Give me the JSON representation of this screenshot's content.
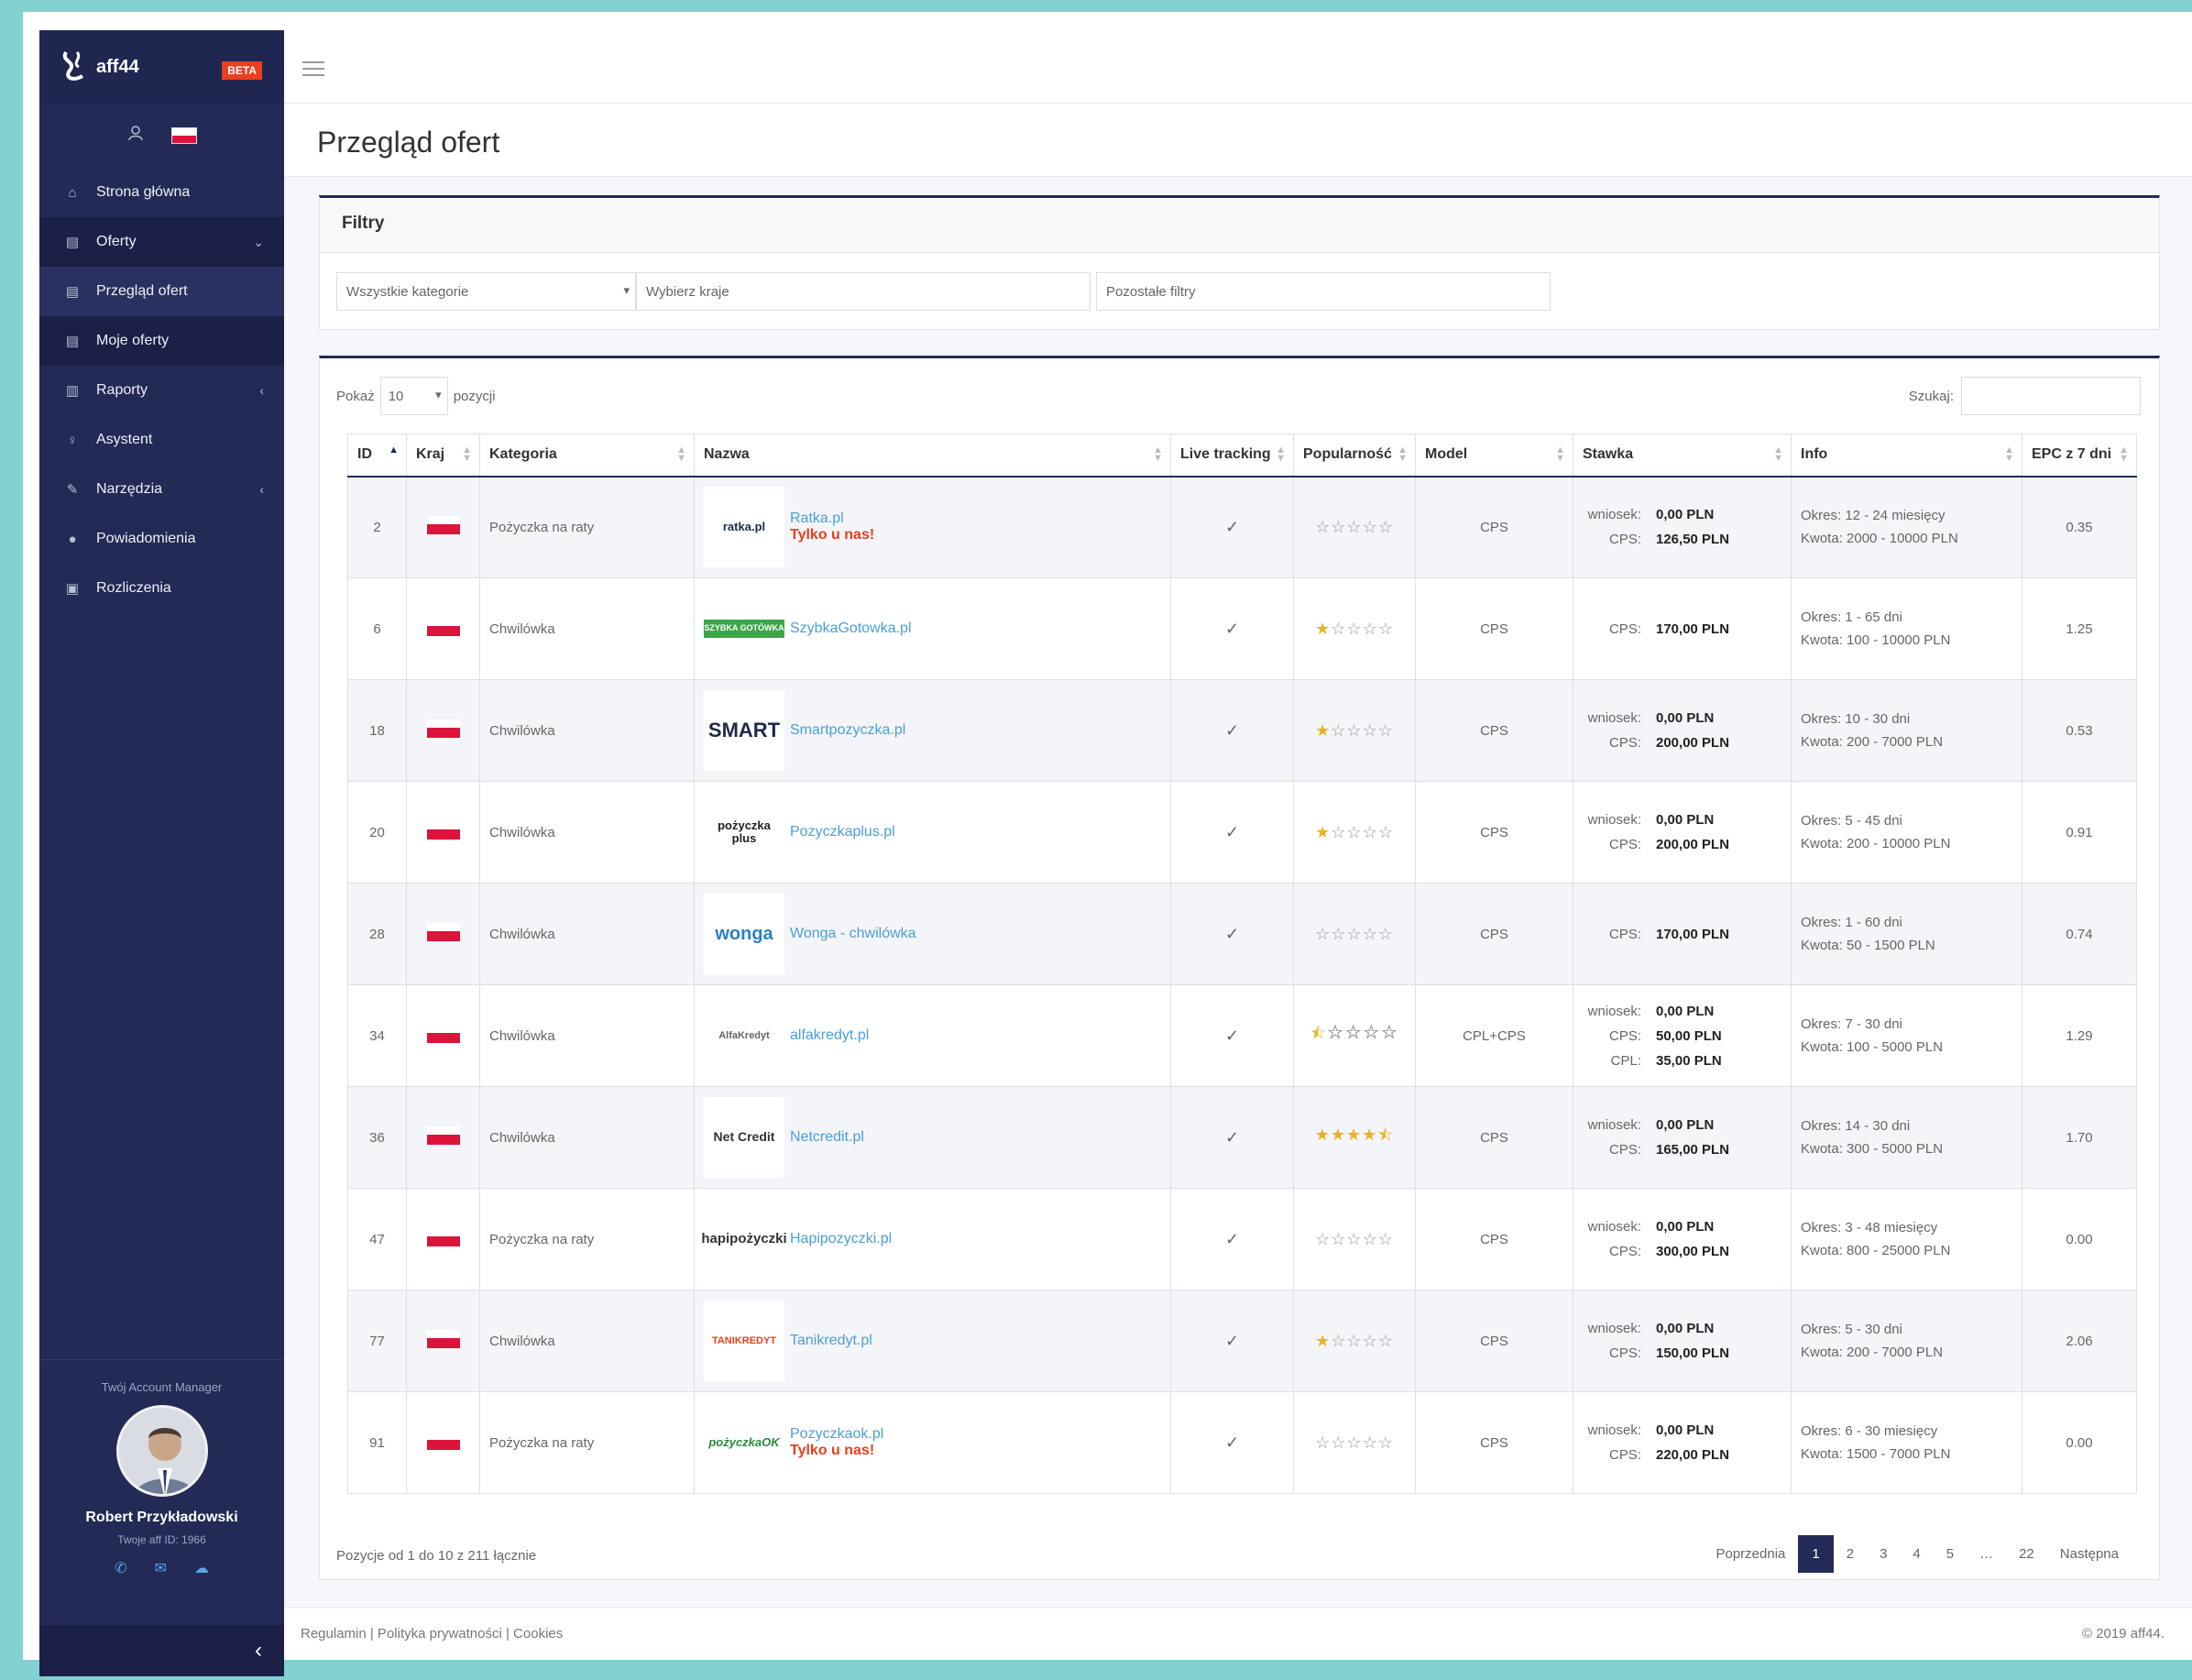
{
  "brand": {
    "name": "aff44",
    "badge": "BETA"
  },
  "sidebar": {
    "items": [
      {
        "label": "Strona główna",
        "icon": "home-icon"
      },
      {
        "label": "Oferty",
        "icon": "id-card-icon",
        "caret": "⌄"
      },
      {
        "label": "Przegląd ofert",
        "icon": "id-card-icon"
      },
      {
        "label": "Moje oferty",
        "icon": "id-card-icon"
      },
      {
        "label": "Raporty",
        "icon": "bar-chart-icon",
        "caret": "‹"
      },
      {
        "label": "Asystent",
        "icon": "lightbulb-icon"
      },
      {
        "label": "Narzędzia",
        "icon": "wrench-icon",
        "caret": "‹"
      },
      {
        "label": "Powiadomienia",
        "icon": "chat-icon"
      },
      {
        "label": "Rozliczenia",
        "icon": "money-icon"
      }
    ],
    "manager": {
      "title": "Twój Account Manager",
      "name": "Robert Przykładowski",
      "aff_id": "Twoje aff ID: 1966"
    }
  },
  "page": {
    "title": "Przegląd ofert"
  },
  "filters": {
    "title": "Filtry",
    "category": "Wszystkie kategorie",
    "country_placeholder": "Wybierz kraje",
    "other_placeholder": "Pozostałe filtry"
  },
  "table": {
    "show_label": "Pokaż",
    "page_len": "10",
    "items_label": "pozycji",
    "search_label": "Szukaj:",
    "headers": [
      "ID",
      "Kraj",
      "Kategoria",
      "Nazwa",
      "Live tracking",
      "Popularność",
      "Model",
      "Stawka",
      "Info",
      "EPC z 7 dni"
    ],
    "rows": [
      {
        "id": "2",
        "category": "Pożyczka na raty",
        "logo": "ratka.pl",
        "name": "Ratka.pl",
        "exclusive": "Tylko u nas!",
        "tracking": "✓",
        "stars": 0,
        "model": "CPS",
        "rates": [
          [
            "wniosek:",
            "0,00 PLN"
          ],
          [
            "CPS:",
            "126,50 PLN"
          ]
        ],
        "period": "Okres: 12 - 24 miesięcy",
        "amount": "Kwota: 2000 - 10000 PLN",
        "epc": "0.35"
      },
      {
        "id": "6",
        "category": "Chwilówka",
        "logo": "SZYBKA GOTÓWKA",
        "name": "SzybkaGotowka.pl",
        "exclusive": "",
        "tracking": "✓",
        "stars": 1,
        "model": "CPS",
        "rates": [
          [
            "CPS:",
            "170,00 PLN"
          ]
        ],
        "period": "Okres: 1 - 65 dni",
        "amount": "Kwota: 100 - 10000 PLN",
        "epc": "1.25"
      },
      {
        "id": "18",
        "category": "Chwilówka",
        "logo": "SMART",
        "name": "Smartpozyczka.pl",
        "exclusive": "",
        "tracking": "✓",
        "stars": 1,
        "model": "CPS",
        "rates": [
          [
            "wniosek:",
            "0,00 PLN"
          ],
          [
            "CPS:",
            "200,00 PLN"
          ]
        ],
        "period": "Okres: 10 - 30 dni",
        "amount": "Kwota: 200 - 7000 PLN",
        "epc": "0.53"
      },
      {
        "id": "20",
        "category": "Chwilówka",
        "logo": "pożyczka plus",
        "name": "Pozyczkaplus.pl",
        "exclusive": "",
        "tracking": "✓",
        "stars": 1,
        "model": "CPS",
        "rates": [
          [
            "wniosek:",
            "0,00 PLN"
          ],
          [
            "CPS:",
            "200,00 PLN"
          ]
        ],
        "period": "Okres: 5 - 45 dni",
        "amount": "Kwota: 200 - 10000 PLN",
        "epc": "0.91"
      },
      {
        "id": "28",
        "category": "Chwilówka",
        "logo": "wonga",
        "name": "Wonga - chwilówka",
        "exclusive": "",
        "tracking": "✓",
        "stars": 0,
        "model": "CPS",
        "rates": [
          [
            "CPS:",
            "170,00 PLN"
          ]
        ],
        "period": "Okres: 1 - 60 dni",
        "amount": "Kwota: 50 - 1500 PLN",
        "epc": "0.74"
      },
      {
        "id": "34",
        "category": "Chwilówka",
        "logo": "AlfaKredyt",
        "name": "alfakredyt.pl",
        "exclusive": "",
        "tracking": "✓",
        "stars": 0.5,
        "model": "CPL+CPS",
        "rates": [
          [
            "wniosek:",
            "0,00 PLN"
          ],
          [
            "CPS:",
            "50,00 PLN"
          ],
          [
            "CPL:",
            "35,00 PLN"
          ]
        ],
        "period": "Okres: 7 - 30 dni",
        "amount": "Kwota: 100 - 5000 PLN",
        "epc": "1.29"
      },
      {
        "id": "36",
        "category": "Chwilówka",
        "logo": "Net Credit",
        "name": "Netcredit.pl",
        "exclusive": "",
        "tracking": "✓",
        "stars": 4.5,
        "model": "CPS",
        "rates": [
          [
            "wniosek:",
            "0,00 PLN"
          ],
          [
            "CPS:",
            "165,00 PLN"
          ]
        ],
        "period": "Okres: 14 - 30 dni",
        "amount": "Kwota: 300 - 5000 PLN",
        "epc": "1.70"
      },
      {
        "id": "47",
        "category": "Pożyczka na raty",
        "logo": "hapipożyczki",
        "name": "Hapipozyczki.pl",
        "exclusive": "",
        "tracking": "✓",
        "stars": 0,
        "model": "CPS",
        "rates": [
          [
            "wniosek:",
            "0,00 PLN"
          ],
          [
            "CPS:",
            "300,00 PLN"
          ]
        ],
        "period": "Okres: 3 - 48 miesięcy",
        "amount": "Kwota: 800 - 25000 PLN",
        "epc": "0.00"
      },
      {
        "id": "77",
        "category": "Chwilówka",
        "logo": "TANIKREDYT",
        "name": "Tanikredyt.pl",
        "exclusive": "",
        "tracking": "✓",
        "stars": 1,
        "model": "CPS",
        "rates": [
          [
            "wniosek:",
            "0,00 PLN"
          ],
          [
            "CPS:",
            "150,00 PLN"
          ]
        ],
        "period": "Okres: 5 - 30 dni",
        "amount": "Kwota: 200 - 7000 PLN",
        "epc": "2.06"
      },
      {
        "id": "91",
        "category": "Pożyczka na raty",
        "logo": "pożyczkaOK",
        "name": "Pozyczkaok.pl",
        "exclusive": "Tylko u nas!",
        "tracking": "✓",
        "stars": 0,
        "model": "CPS",
        "rates": [
          [
            "wniosek:",
            "0,00 PLN"
          ],
          [
            "CPS:",
            "220,00 PLN"
          ]
        ],
        "period": "Okres: 6 - 30 miesięcy",
        "amount": "Kwota: 1500 - 7000 PLN",
        "epc": "0.00"
      }
    ],
    "summary": "Pozycje od 1 do 10 z 211 łącznie",
    "pagination": [
      "Poprzednia",
      "1",
      "2",
      "3",
      "4",
      "5",
      "…",
      "22",
      "Następna"
    ],
    "current_page": "1"
  },
  "footer": {
    "links": "Regulamin  |  Polityka prywatności  |  Cookies",
    "copyright": "© 2019 aff44."
  },
  "colors": {
    "sidebar": "#222a55",
    "accent": "#4a9fd8",
    "beta": "#e8401f",
    "exclusive": "#e8401f",
    "star": "#e6b422",
    "check": "#2ca02c"
  }
}
